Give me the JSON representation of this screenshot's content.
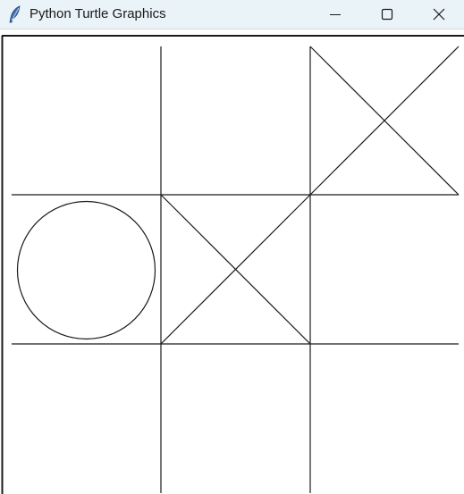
{
  "window": {
    "title": "Python Turtle Graphics",
    "controls": {
      "minimize": "minimize-icon",
      "maximize": "maximize-icon",
      "close": "close-icon"
    },
    "app_icon": "feather-icon"
  },
  "board": {
    "size": 3,
    "cells": [
      [
        "",
        "",
        "X"
      ],
      [
        "O",
        "X",
        ""
      ],
      [
        "",
        "",
        ""
      ]
    ]
  },
  "colors": {
    "titlebar": "#eaf3f8",
    "ink": "#1a1a1a",
    "canvas": "#ffffff"
  }
}
